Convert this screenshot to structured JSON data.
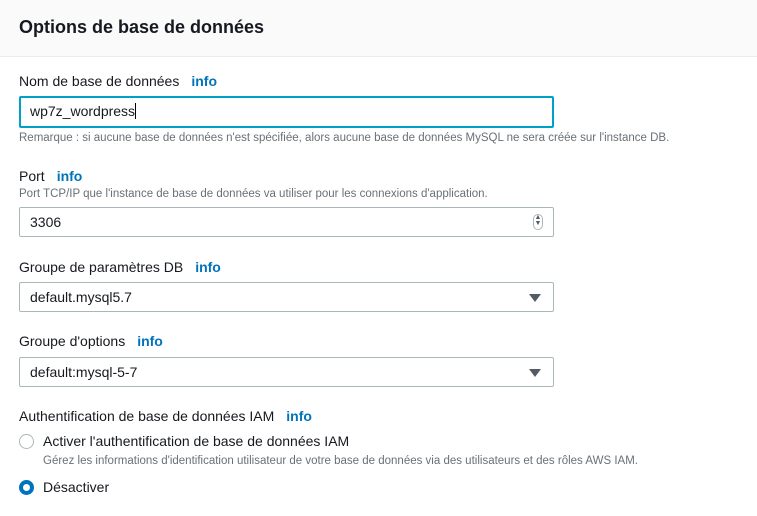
{
  "header": {
    "title": "Options de base de données"
  },
  "info_label": "info",
  "db_name": {
    "label": "Nom de base de données",
    "value": "wp7z_wordpress",
    "note": "Remarque : si aucune base de données n'est spécifiée, alors aucune base de données MySQL ne sera créée sur l'instance DB."
  },
  "port": {
    "label": "Port",
    "description": "Port TCP/IP que l'instance de base de données va utiliser pour les connexions d'application.",
    "value": "3306"
  },
  "param_group": {
    "label": "Groupe de paramètres DB",
    "value": "default.mysql5.7"
  },
  "option_group": {
    "label": "Groupe d'options",
    "value": "default:mysql-5-7"
  },
  "iam": {
    "label": "Authentification de base de données IAM",
    "options": [
      {
        "label": "Activer l'authentification de base de données IAM",
        "description": "Gérez les informations d'identification utilisateur de votre base de données via des utilisateurs et des rôles AWS IAM.",
        "selected": false
      },
      {
        "label": "Désactiver",
        "selected": true
      }
    ]
  },
  "colors": {
    "accent": "#0073bb",
    "focus": "#00a1c9"
  }
}
